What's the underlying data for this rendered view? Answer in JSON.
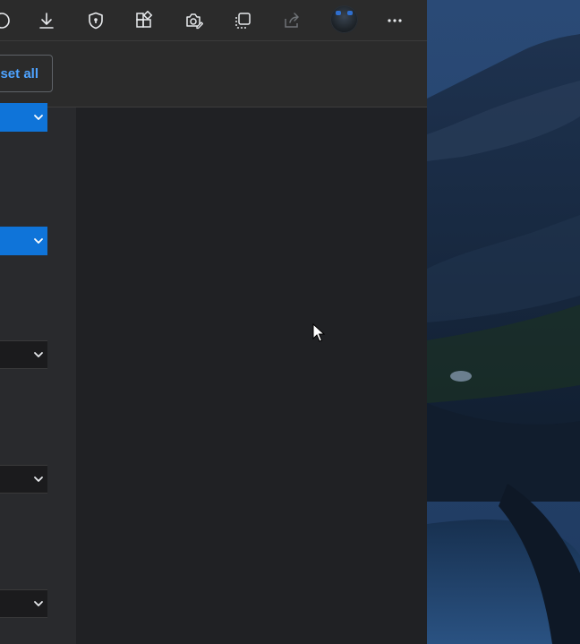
{
  "toolbar": {
    "icons": [
      {
        "name": "circle-icon"
      },
      {
        "name": "download-icon"
      },
      {
        "name": "shield-icon"
      },
      {
        "name": "extensions-icon"
      },
      {
        "name": "screenshot-icon"
      },
      {
        "name": "collections-icon"
      },
      {
        "name": "share-icon"
      },
      {
        "name": "more-icon"
      }
    ]
  },
  "subheader": {
    "reset_label": "set all"
  },
  "dropdowns": [
    {
      "style": "blue",
      "value": ""
    },
    {
      "style": "blue",
      "value": ""
    },
    {
      "style": "dark",
      "value": ""
    },
    {
      "style": "dark",
      "value": ""
    },
    {
      "style": "dark",
      "value": ""
    }
  ],
  "colors": {
    "accent": "#0f74d9",
    "link": "#4ea3ff",
    "panel": "#202124",
    "toolbar": "#2b2b2b"
  }
}
